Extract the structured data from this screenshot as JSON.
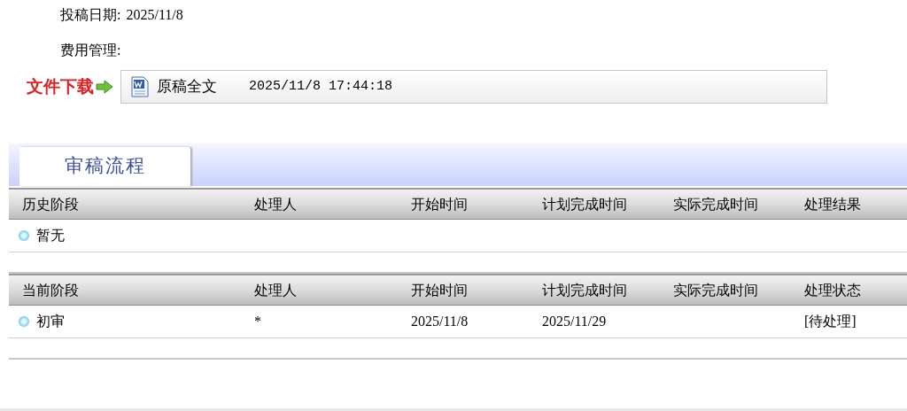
{
  "info": [
    {
      "label": "投稿日期:",
      "value": "2025/11/8"
    },
    {
      "label": "费用管理:"
    }
  ],
  "download": {
    "label": "文件下载",
    "file": {
      "name": "原稿全文",
      "time": "2025/11/8 17:44:18"
    }
  },
  "tabs": [
    {
      "label": "审稿流程",
      "selected": true
    }
  ],
  "sections": [
    {
      "columns": [
        "历史阶段",
        "处理人",
        "开始时间",
        "计划完成时间",
        "实际完成时间",
        "处理结果"
      ],
      "rows": [
        {
          "cells": [
            "暂无"
          ]
        }
      ]
    },
    {
      "columns": [
        "当前阶段",
        "处理人",
        "开始时间",
        "计划完成时间",
        "实际完成时间",
        "处理状态"
      ],
      "rows": [
        {
          "cells": [
            "初审",
            "*",
            "2025/11/8",
            "2025/11/29",
            null,
            "[待处理]"
          ]
        }
      ]
    }
  ]
}
